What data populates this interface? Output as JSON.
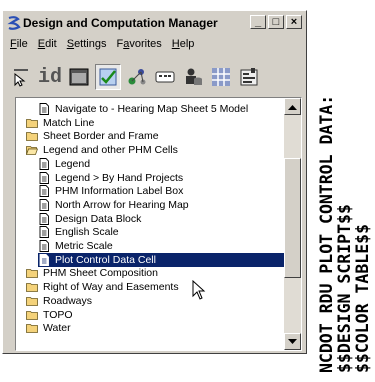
{
  "window": {
    "title": "Design and Computation Manager",
    "min_label": "_",
    "max_label": "□",
    "close_label": "×"
  },
  "menu": [
    "File",
    "Edit",
    "Settings",
    "Favorites",
    "Help"
  ],
  "menu_underline": [
    "F",
    "E",
    "S",
    "a",
    "H"
  ],
  "toolbar": {
    "id_label": "id",
    "icons": [
      "pointer-icon",
      "id-icon",
      "dialog-icon",
      "check-clipboard-icon",
      "nodes-icon",
      "keyboard-icon",
      "person-database-icon",
      "grid-icon",
      "form-icon"
    ]
  },
  "tree": [
    {
      "label": "Navigate to - Hearing Map Sheet 5 Model",
      "type": "doc",
      "level": 2
    },
    {
      "label": "Match Line",
      "type": "folder",
      "level": 1
    },
    {
      "label": "Sheet Border and Frame",
      "type": "folder",
      "level": 1
    },
    {
      "label": "Legend and other PHM Cells",
      "type": "folder-open",
      "level": 1
    },
    {
      "label": "Legend",
      "type": "doc",
      "level": 2
    },
    {
      "label": "Legend > By Hand Projects",
      "type": "doc",
      "level": 2
    },
    {
      "label": "PHM Information Label Box",
      "type": "doc",
      "level": 2
    },
    {
      "label": "North Arrow for Hearing Map",
      "type": "doc",
      "level": 2
    },
    {
      "label": "Design Data Block",
      "type": "doc",
      "level": 2
    },
    {
      "label": "English Scale",
      "type": "doc",
      "level": 2
    },
    {
      "label": "Metric  Scale",
      "type": "doc",
      "level": 2
    },
    {
      "label": "Plot Control Data Cell",
      "type": "doc",
      "level": 2,
      "selected": true
    },
    {
      "label": "PHM Sheet Composition",
      "type": "folder",
      "level": 1
    },
    {
      "label": "Right of Way and Easements",
      "type": "folder",
      "level": 1
    },
    {
      "label": "Roadways",
      "type": "folder",
      "level": 1
    },
    {
      "label": "TOPO",
      "type": "folder",
      "level": 1
    },
    {
      "label": "Water",
      "type": "folder",
      "level": 1
    }
  ],
  "side_text": [
    "NCDOT RDU PLOT CONTROL DATA:",
    "$$DESIGN SCRIPT$$",
    "$$COLOR TABLE$$"
  ],
  "colors": {
    "selection": "#0a246a",
    "folder": "#f4d27a",
    "window_bg": "#d4d0c8"
  }
}
